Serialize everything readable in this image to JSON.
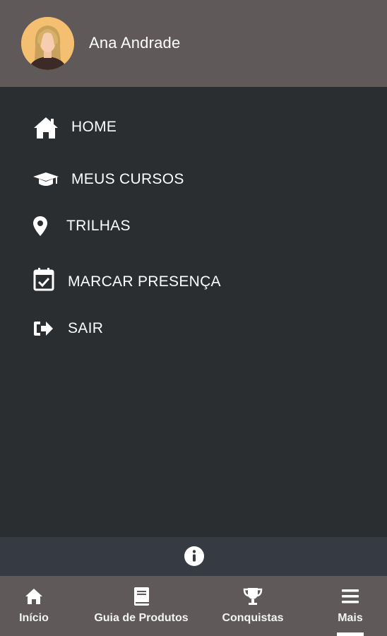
{
  "header": {
    "user_name": "Ana Andrade",
    "avatar_icon": "user-avatar-blonde-woman"
  },
  "menu": {
    "items": [
      {
        "label": "HOME",
        "icon": "home-icon"
      },
      {
        "label": "MEUS CURSOS",
        "icon": "graduation-cap-icon"
      },
      {
        "label": "TRILHAS",
        "icon": "map-marker-icon"
      },
      {
        "label": "MARCAR PRESENÇA",
        "icon": "calendar-check-icon"
      },
      {
        "label": "SAIR",
        "icon": "sign-out-icon"
      }
    ]
  },
  "info_bar": {
    "icon": "info-icon"
  },
  "bottom_nav": {
    "items": [
      {
        "label": "Início",
        "icon": "home-icon"
      },
      {
        "label": "Guia de Produtos",
        "icon": "book-icon"
      },
      {
        "label": "Conquistas",
        "icon": "trophy-icon"
      },
      {
        "label": "Mais",
        "icon": "menu-icon",
        "active": true
      }
    ]
  },
  "colors": {
    "header_bg": "#5f595a",
    "menu_bg": "#2b2e31",
    "info_bar_bg": "#363a43",
    "bottom_nav_bg": "#5f595a",
    "text": "#ffffff",
    "avatar_bg": "#f5bf72"
  }
}
